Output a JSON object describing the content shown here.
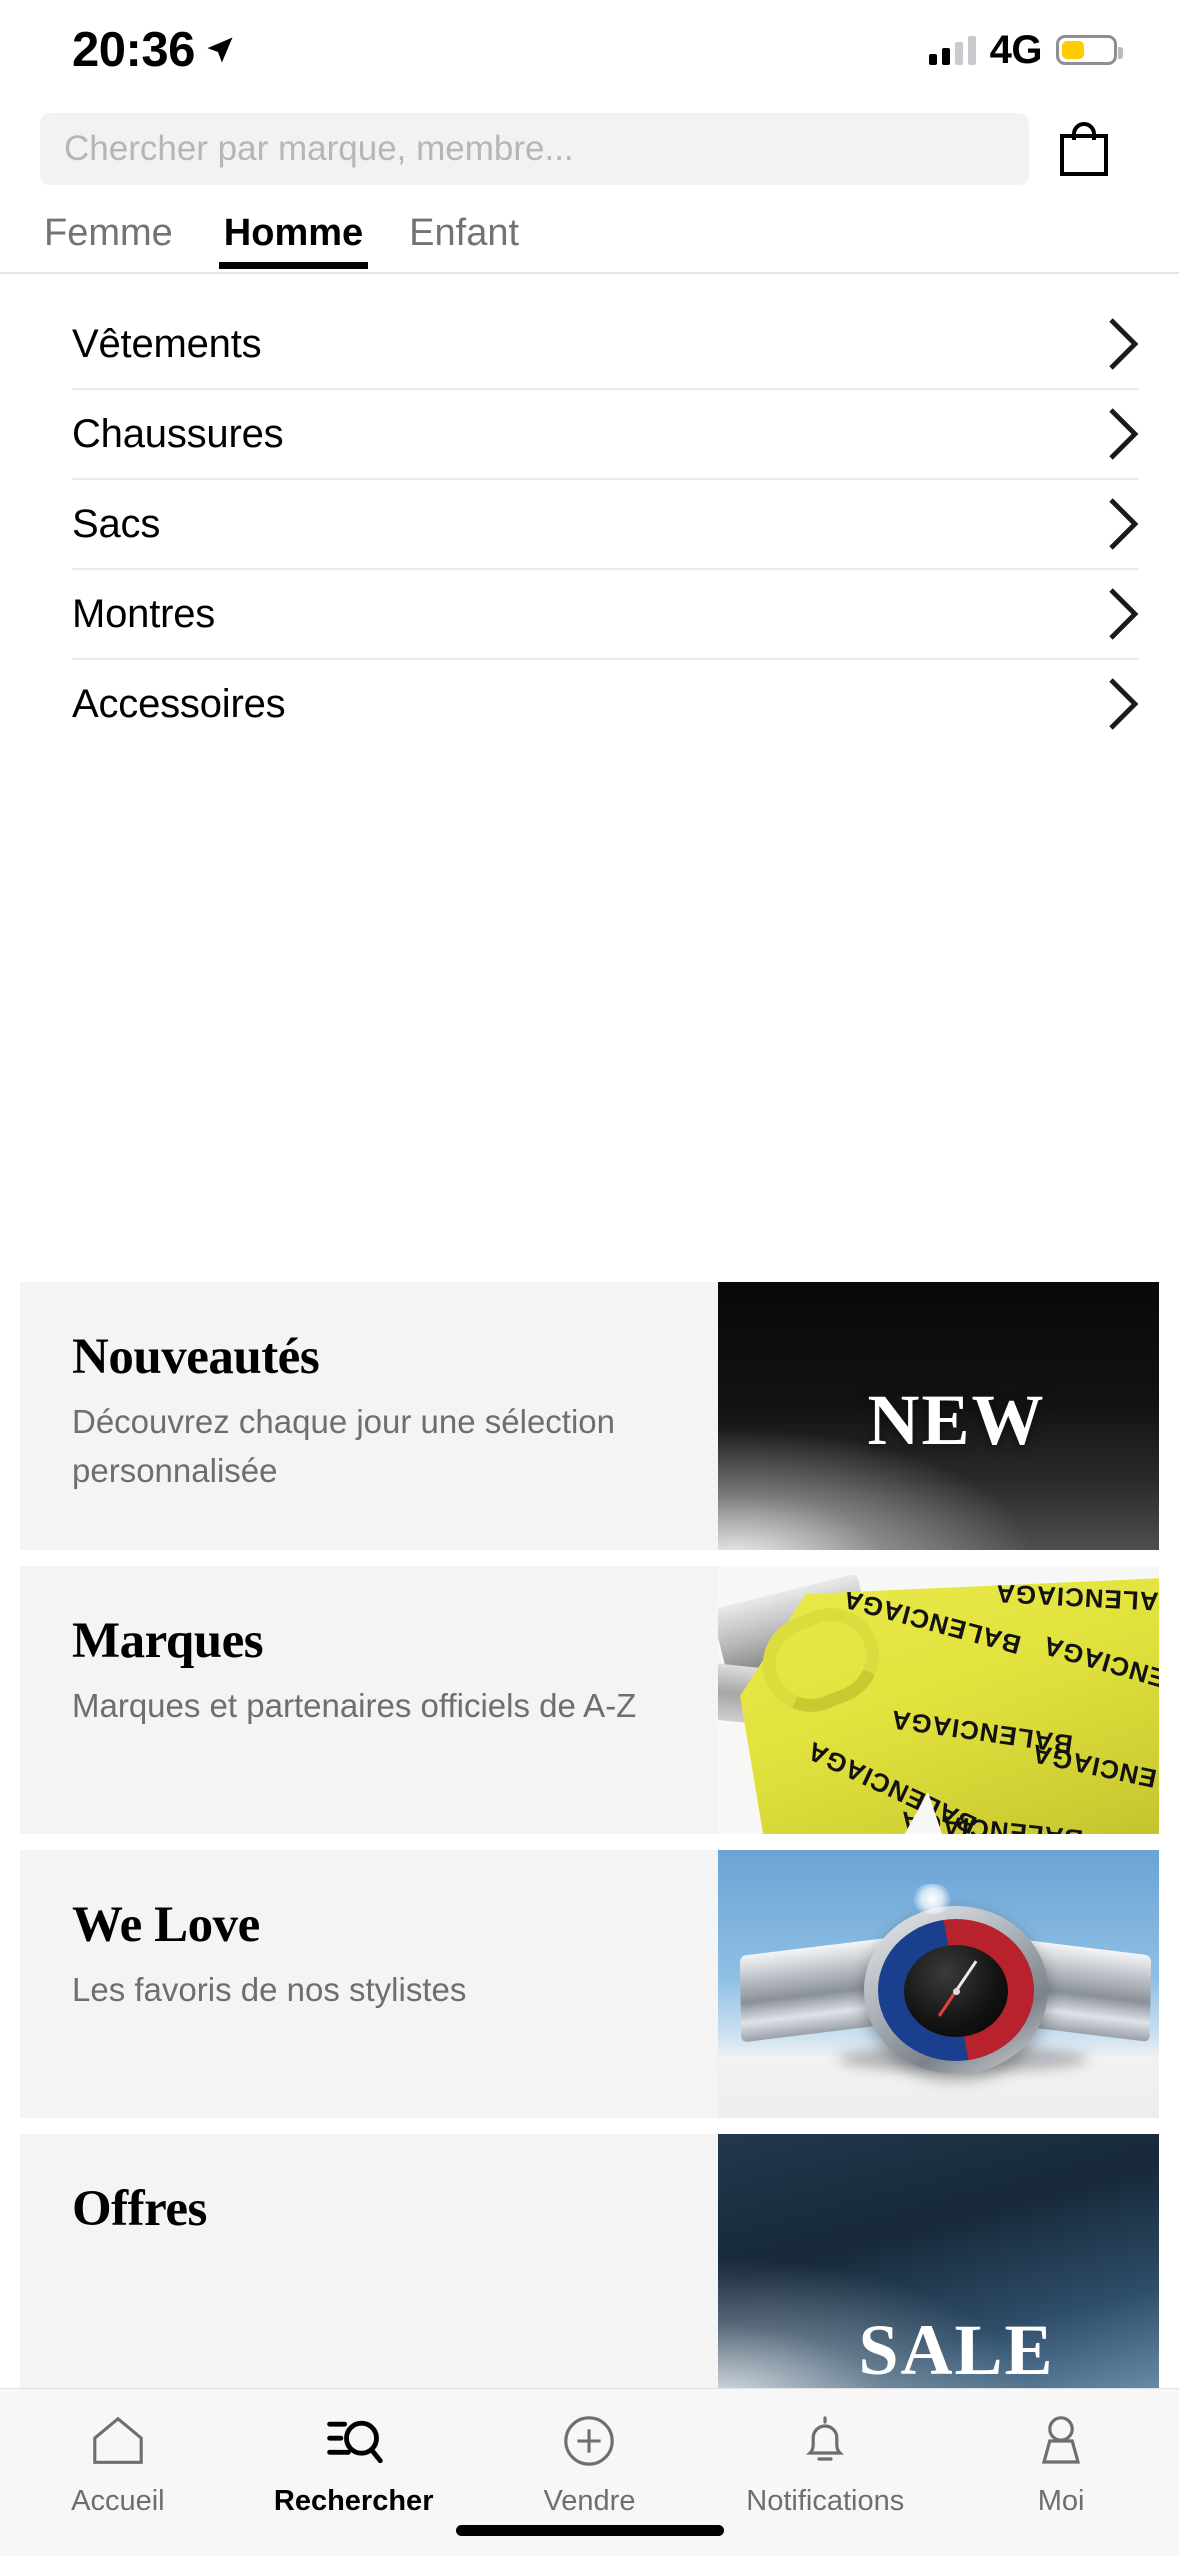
{
  "status_bar": {
    "time": "20:36",
    "location_icon": "location-arrow-icon",
    "signal_icon": "cellular-signal-icon",
    "signal_bars_filled": 2,
    "signal_bars_total": 4,
    "network": "4G",
    "battery_icon": "battery-icon",
    "battery_color": "#ffcc00",
    "battery_level_percent": 45
  },
  "header": {
    "search_placeholder": "Chercher par marque, membre...",
    "search_value": "",
    "search_icon": "search-input",
    "bag_icon": "shopping-bag-icon"
  },
  "gender_tabs": {
    "items": [
      {
        "label": "Femme",
        "active": false
      },
      {
        "label": "Homme",
        "active": true
      },
      {
        "label": "Enfant",
        "active": false
      }
    ]
  },
  "categories": [
    {
      "label": "Vêtements",
      "chevron": "chevron-right-icon"
    },
    {
      "label": "Chaussures",
      "chevron": "chevron-right-icon"
    },
    {
      "label": "Sacs",
      "chevron": "chevron-right-icon"
    },
    {
      "label": "Montres",
      "chevron": "chevron-right-icon"
    },
    {
      "label": "Accessoires",
      "chevron": "chevron-right-icon"
    }
  ],
  "promo_cards": [
    {
      "title": "Nouveautés",
      "subtitle": "Découvrez chaque jour une sélection personnalisée",
      "image_word": "NEW",
      "image_kind": "dark-gradient-new"
    },
    {
      "title": "Marques",
      "subtitle": "Marques et partenaires officiels de A-Z",
      "image_word": "",
      "image_kind": "balenciaga-yellow-sweater",
      "image_text": "BALENCIAGA"
    },
    {
      "title": "We Love",
      "subtitle": "Les favoris de nos stylistes",
      "image_word": "",
      "image_kind": "rolex-gmt-pepsi-watch"
    },
    {
      "title": "Offres",
      "subtitle": "",
      "image_word": "SALE",
      "image_kind": "blue-gradient-sale"
    }
  ],
  "bottom_nav": {
    "items": [
      {
        "label": "Accueil",
        "icon": "home-icon",
        "active": false
      },
      {
        "label": "Rechercher",
        "icon": "search-icon",
        "active": true
      },
      {
        "label": "Vendre",
        "icon": "plus-circle-icon",
        "active": false
      },
      {
        "label": "Notifications",
        "icon": "bell-icon",
        "active": false
      },
      {
        "label": "Moi",
        "icon": "person-icon",
        "active": false
      }
    ]
  },
  "colors": {
    "accent": "#000000",
    "card_background": "#f4f4f4",
    "muted_text": "#6e6e6e",
    "battery_warning": "#ffcc00"
  }
}
